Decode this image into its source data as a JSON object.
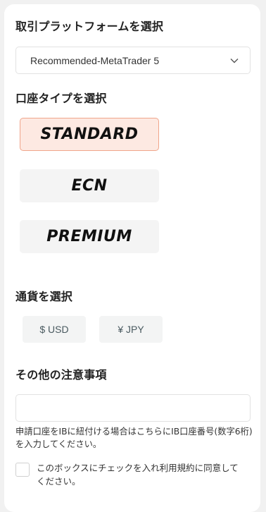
{
  "platform": {
    "heading": "取引プラットフォームを選択",
    "selected": "Recommended-MetaTrader 5"
  },
  "account_type": {
    "heading": "口座タイプを選択",
    "options": [
      "STANDARD",
      "ECN",
      "PREMIUM"
    ],
    "selected": "STANDARD"
  },
  "currency": {
    "heading": "通貨を選択",
    "options": [
      "$ USD",
      "¥ JPY"
    ]
  },
  "notes": {
    "heading": "その他の注意事項",
    "ib_input_value": "",
    "hint": "申請口座をIBに紐付ける場合はこちらにIB口座番号(数字6桁)を入力してください。"
  },
  "agreement": {
    "label": "このボックスにチェックを入れ利用規約に同意してください。",
    "checked": false
  },
  "colors": {
    "selected_bg": "#fde9e2",
    "selected_border": "#f0a58a",
    "button_bg": "#f4f4f4"
  },
  "icons": {
    "dropdown": "chevron-down-icon"
  }
}
